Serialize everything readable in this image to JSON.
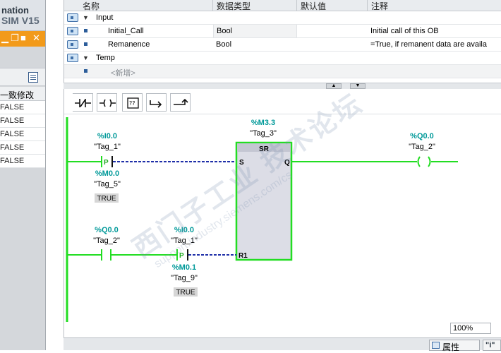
{
  "left_panel": {
    "title_line1": "nation",
    "title_line2": "SIM V15",
    "column_header": "一致修改",
    "rows": [
      "FALSE",
      "FALSE",
      "FALSE",
      "FALSE",
      "FALSE"
    ]
  },
  "interface": {
    "headers": {
      "name": "名称",
      "type": "数据类型",
      "default": "默认值",
      "comment": "注释"
    },
    "rows": [
      {
        "name": "Input",
        "type": "",
        "comment": "",
        "expanded": true
      },
      {
        "name": "Initial_Call",
        "type": "Bool",
        "comment": "Initial call of this OB"
      },
      {
        "name": "Remanence",
        "type": "Bool",
        "comment": "=True, if remanent data are availa"
      },
      {
        "name": "Temp",
        "type": "",
        "comment": "",
        "expanded": true
      },
      {
        "name": "<新增>",
        "type": "",
        "comment": ""
      }
    ]
  },
  "editor": {
    "zoom": "100%",
    "network": {
      "sr_block": {
        "addr": "%M3.3",
        "tag": "\"Tag_3\"",
        "title": "SR",
        "pin_s": "S",
        "pin_r1": "R1",
        "pin_q": "Q"
      },
      "contact_p1": {
        "addr": "%I0.0",
        "tag": "\"Tag_1\"",
        "symbol": "P",
        "edge_addr": "%M0.0",
        "edge_tag": "\"Tag_5\"",
        "edge_value": "TRUE"
      },
      "coil": {
        "addr": "%Q0.0",
        "tag": "\"Tag_2\""
      },
      "contact_no": {
        "addr": "%Q0.0",
        "tag": "\"Tag_2\""
      },
      "contact_p2": {
        "addr": "%I0.0",
        "tag": "\"Tag_1\"",
        "symbol": "P",
        "edge_addr": "%M0.1",
        "edge_tag": "\"Tag_9\"",
        "edge_value": "TRUE"
      }
    }
  },
  "bottom": {
    "properties_tab": "属性",
    "info_tab": "\"i\""
  },
  "watermark": {
    "brand": "西门子工业  技术论坛",
    "url": "support.industry.siemens.com/cs"
  },
  "colors": {
    "energized": "#22dd22",
    "address": "#009999",
    "dashed_link": "#1f2fa8",
    "block_fill": "#dcdde6"
  }
}
